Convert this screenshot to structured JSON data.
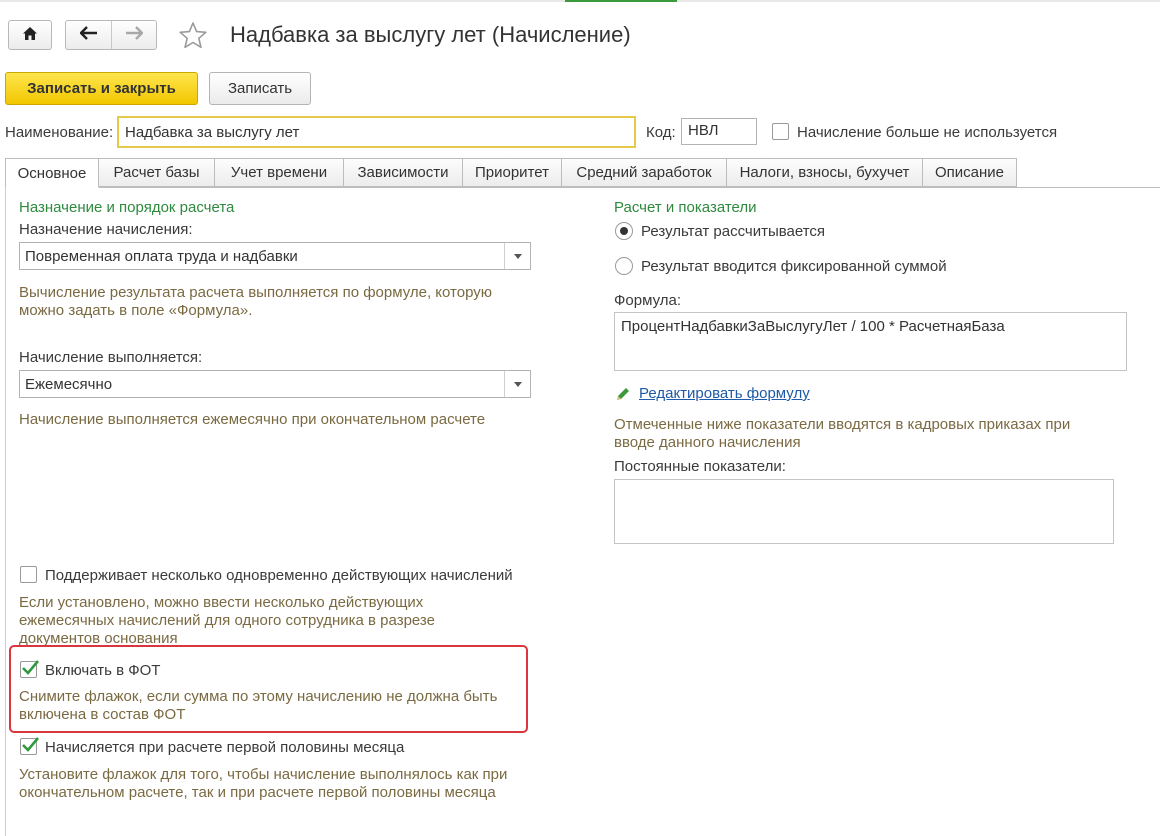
{
  "header": {
    "title": "Надбавка за выслугу лет (Начисление)",
    "home_icon": "home-icon",
    "back_icon": "arrow-left-icon",
    "forward_icon": "arrow-right-icon",
    "favorite_icon": "star-icon"
  },
  "toolbar": {
    "save_close_label": "Записать и закрыть",
    "save_label": "Записать"
  },
  "form": {
    "name_label": "Наименование:",
    "name_value": "Надбавка за выслугу лет",
    "code_label": "Код:",
    "code_value": "НВЛ",
    "not_used_label": "Начисление больше не используется"
  },
  "tabs": [
    {
      "label": "Основное"
    },
    {
      "label": "Расчет базы"
    },
    {
      "label": "Учет времени"
    },
    {
      "label": "Зависимости"
    },
    {
      "label": "Приоритет"
    },
    {
      "label": "Средний заработок"
    },
    {
      "label": "Налоги, взносы, бухучет"
    },
    {
      "label": "Описание"
    }
  ],
  "left": {
    "section_title": "Назначение и порядок расчета",
    "purpose_label": "Назначение начисления:",
    "purpose_value": "Повременная оплата труда и надбавки",
    "purpose_hint": "Вычисление результата расчета выполняется по формуле, которую можно задать в поле «Формула».",
    "frequency_label": "Начисление выполняется:",
    "frequency_value": "Ежемесячно",
    "frequency_hint": "Начисление выполняется ежемесячно при окончательном расчете",
    "multiple_label": "Поддерживает несколько одновременно действующих начислений",
    "multiple_hint": "Если установлено, можно ввести несколько действующих ежемесячных начислений для одного сотрудника в разрезе документов основания",
    "fot_label": "Включать в ФОТ",
    "fot_hint": "Снимите флажок, если сумма по этому начислению не должна быть включена в состав ФОТ",
    "half_label": "Начисляется при расчете первой половины месяца",
    "half_hint": "Установите флажок для того, чтобы начисление выполнялось как при окончательном расчете, так и при расчете первой половины месяца"
  },
  "right": {
    "section_title": "Расчет и показатели",
    "radio_calculated": "Результат рассчитывается",
    "radio_fixed": "Результат вводится фиксированной суммой",
    "formula_label": "Формула:",
    "formula_value": "ПроцентНадбавкиЗаВыслугуЛет / 100 * РасчетнаяБаза",
    "edit_formula_link": "Редактировать формулу",
    "indicators_hint": "Отмеченные ниже показатели вводятся в кадровых приказах при вводе данного начисления",
    "permanent_label": "Постоянные показатели:"
  },
  "colors": {
    "accent_yellow": "#f2c700",
    "section_green": "#2e8a3e",
    "hint_brown": "#7a6a42",
    "link_blue": "#1e5aa8",
    "highlight_red": "#d9373d",
    "check_green": "#2e9a3e"
  }
}
